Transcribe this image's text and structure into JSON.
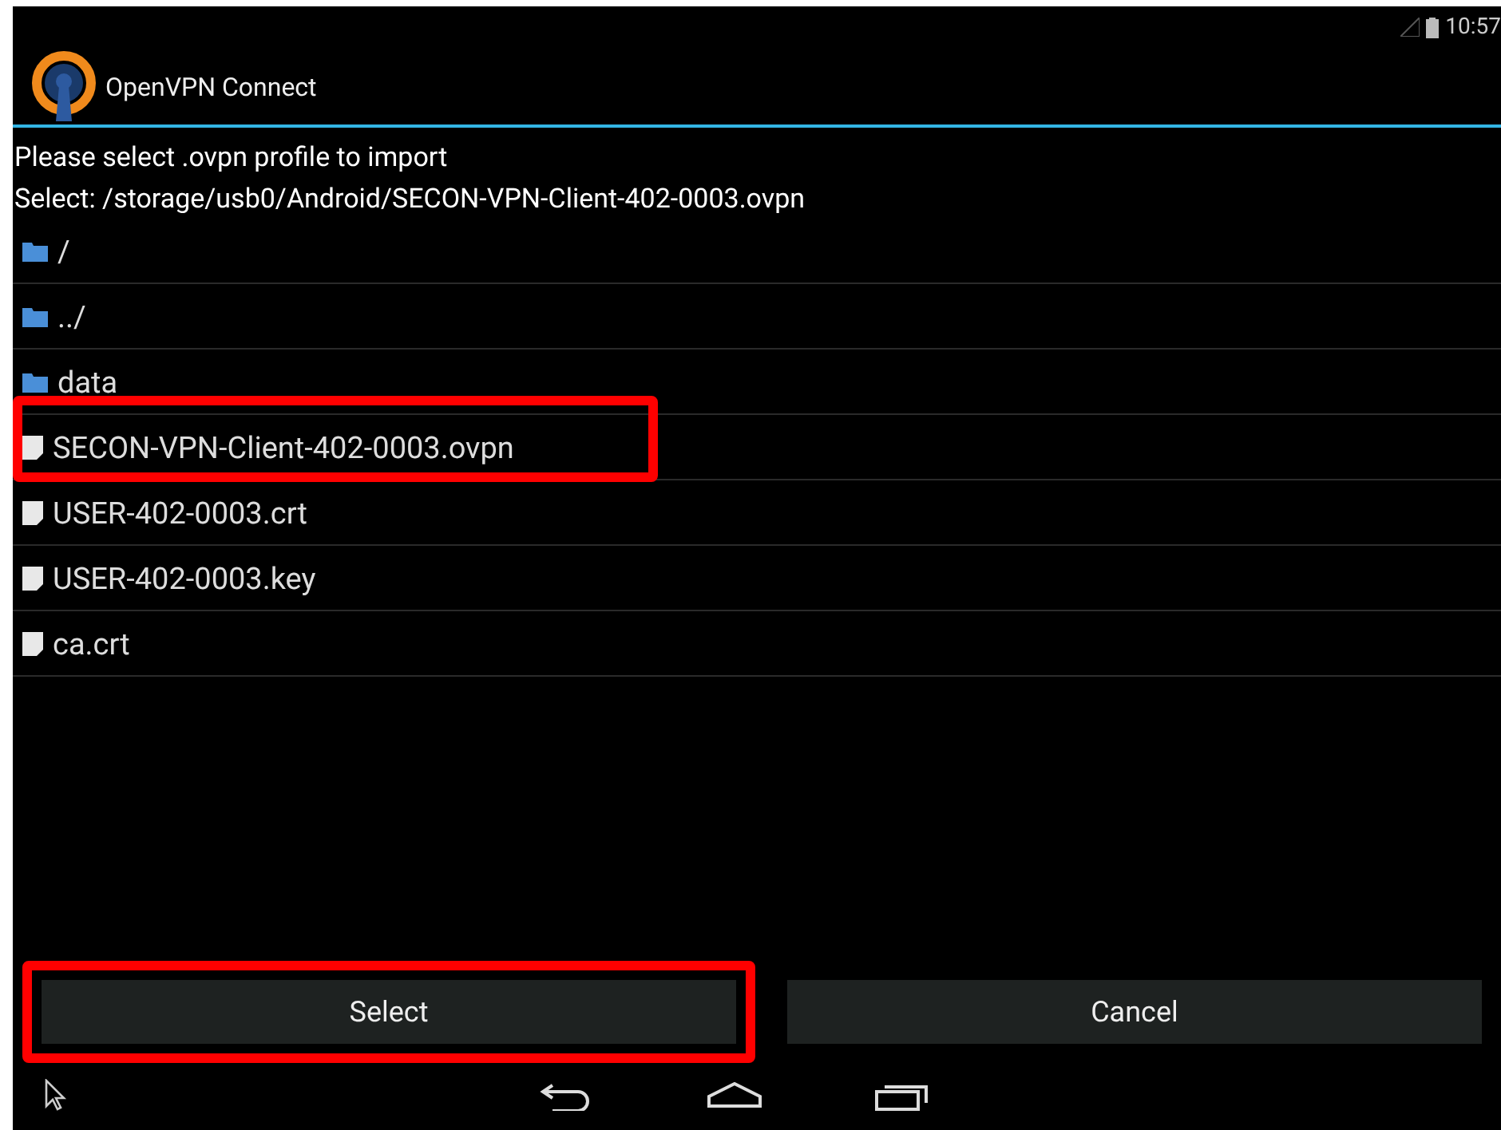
{
  "status_bar": {
    "time": "10:57"
  },
  "action_bar": {
    "title": "OpenVPN Connect"
  },
  "prompt": "Please select .ovpn profile to import",
  "selection": "Select: /storage/usb0/Android/SECON-VPN-Client-402-0003.ovpn",
  "files": [
    {
      "name": "/",
      "kind": "folder",
      "highlighted": false
    },
    {
      "name": "../",
      "kind": "folder",
      "highlighted": false
    },
    {
      "name": "data",
      "kind": "folder",
      "highlighted": false
    },
    {
      "name": "SECON-VPN-Client-402-0003.ovpn",
      "kind": "file",
      "highlighted": true
    },
    {
      "name": "USER-402-0003.crt",
      "kind": "file",
      "highlighted": false
    },
    {
      "name": "USER-402-0003.key",
      "kind": "file",
      "highlighted": false
    },
    {
      "name": "ca.crt",
      "kind": "file",
      "highlighted": false
    }
  ],
  "buttons": [
    {
      "label": "Select",
      "highlighted": true
    },
    {
      "label": "Cancel",
      "highlighted": false
    }
  ]
}
